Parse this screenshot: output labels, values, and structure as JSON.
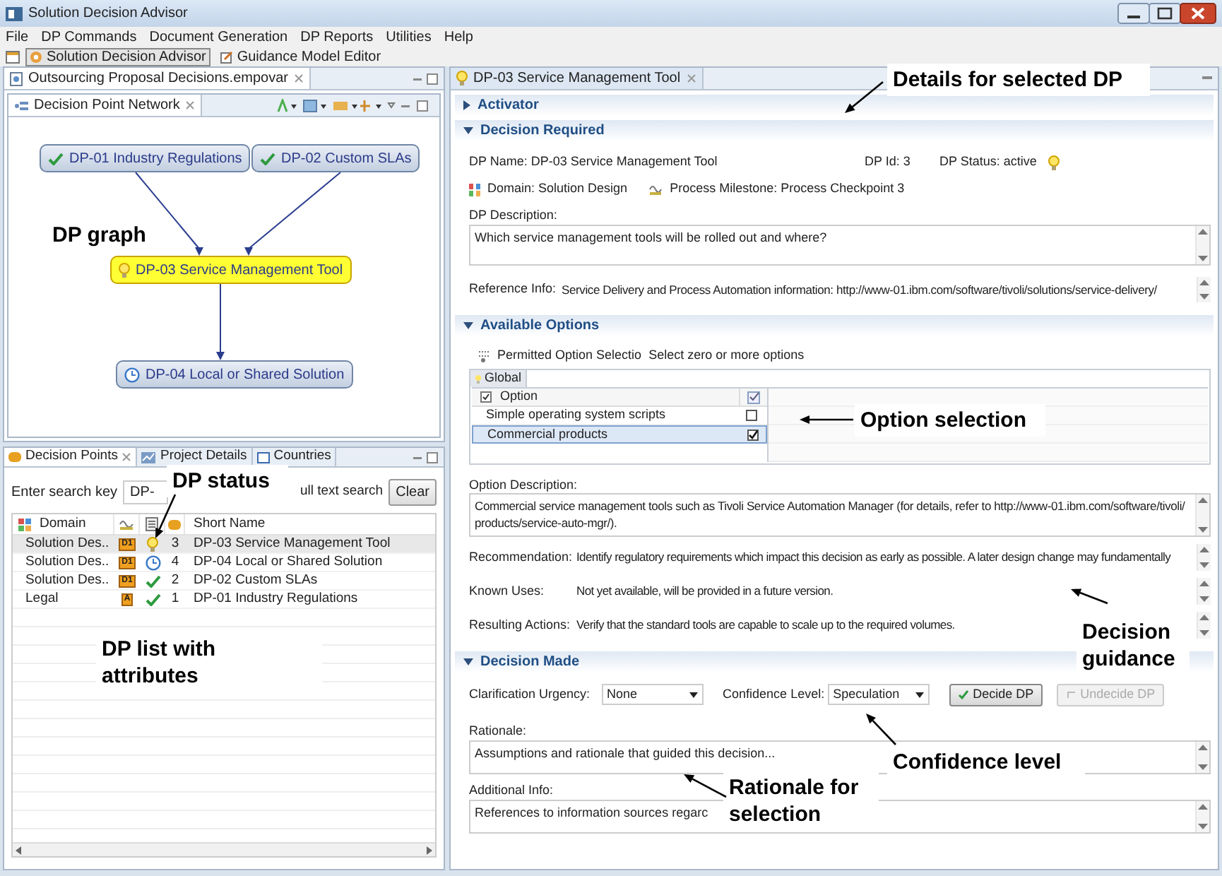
{
  "window": {
    "title": "Solution Decision Advisor"
  },
  "menu": [
    "File",
    "DP Commands",
    "Document Generation",
    "DP Reports",
    "Utilities",
    "Help"
  ],
  "perspectives": [
    {
      "label": "Solution Decision Advisor",
      "selected": true
    },
    {
      "label": "Guidance Model Editor",
      "selected": false
    }
  ],
  "editor_tab": "Outsourcing Proposal Decisions.empovar",
  "network": {
    "tab": "Decision Point Network",
    "nodes": [
      {
        "label": "DP-01 Industry Regulations",
        "kind": "decided",
        "selected": false
      },
      {
        "label": "DP-02 Custom SLAs",
        "kind": "decided",
        "selected": false
      },
      {
        "label": "DP-03 Service Management Tool",
        "kind": "active",
        "selected": true
      },
      {
        "label": "DP-04 Local or Shared Solution",
        "kind": "open",
        "selected": false
      }
    ]
  },
  "points_view": {
    "tabs": [
      {
        "label": "Decision Points",
        "selected": true
      },
      {
        "label": "Project Details",
        "selected": false
      },
      {
        "label": "Countries",
        "selected": false
      }
    ],
    "search_label": "Enter search key",
    "search_value": "DP-",
    "full_text_label": "ull text search",
    "clear_button": "Clear",
    "columns": [
      "Domain",
      "Short Name"
    ],
    "rows": [
      {
        "domain": "Solution Des..",
        "badge": "D1",
        "kind": "active",
        "number": "3",
        "name": "DP-03 Service Management Tool",
        "selected": true
      },
      {
        "domain": "Solution Des..",
        "badge": "D1",
        "kind": "open",
        "number": "4",
        "name": "DP-04 Local or Shared Solution",
        "selected": false
      },
      {
        "domain": "Solution Des..",
        "badge": "D1",
        "kind": "decided",
        "number": "2",
        "name": "DP-02 Custom SLAs",
        "selected": false
      },
      {
        "domain": "Legal",
        "badge": "A",
        "kind": "decided",
        "number": "1",
        "name": "DP-01 Industry Regulations",
        "selected": false
      }
    ]
  },
  "details": {
    "tab": "DP-03 Service Management Tool",
    "activator": {
      "title": "Activator",
      "expanded": false
    },
    "decision_required": {
      "title": "Decision Required",
      "expanded": true,
      "dp_name": "DP Name: DP-03 Service Management Tool",
      "dp_id": "DP Id: 3",
      "dp_status": "DP Status: active",
      "domain": "Domain: Solution Design",
      "milestone": "Process Milestone: Process Checkpoint 3",
      "description_label": "DP Description:",
      "description": "Which service management tools will be rolled out and where?",
      "reference_label": "Reference Info:",
      "reference": "Service Delivery and Process Automation information: http://www-01.ibm.com/software/tivoli/solutions/service-delivery/"
    },
    "available_options": {
      "title": "Available Options",
      "expanded": true,
      "permitted_label": "Permitted Option Selectio",
      "permitted_value": "Select zero or more options",
      "tab": "Global",
      "option_column": "Option",
      "options": [
        {
          "label": "Simple operating system scripts",
          "checked": false,
          "selected": false
        },
        {
          "label": "Commercial products",
          "checked": true,
          "selected": true
        }
      ],
      "description_label": "Option Description:",
      "description": "Commercial service management tools such as Tivoli Service Automation Manager (for details, refer to http://www-01.ibm.com/software/tivoli/products/service-auto-mgr/).",
      "guidance": [
        {
          "label": "Recommendation:",
          "text": "Identify regulatory requirements which impact this decision as early as possible. A later design change may fundamentally"
        },
        {
          "label": "Known Uses:",
          "text": "Not yet available, will be provided in a future version."
        },
        {
          "label": "Resulting Actions:",
          "text": "Verify that the standard tools are capable to scale up to the required volumes."
        }
      ]
    },
    "decision_made": {
      "title": "Decision Made",
      "expanded": true,
      "urgency_label": "Clarification Urgency:",
      "urgency": "None",
      "confidence_label": "Confidence Level:",
      "confidence": "Speculation",
      "buttons": [
        {
          "label": "Decide DP",
          "disabled": false
        },
        {
          "label": "Undecide DP",
          "disabled": true
        }
      ],
      "rationale_label": "Rationale:",
      "rationale": "Assumptions and rationale that guided this decision...",
      "additional_label": "Additional Info:",
      "additional": "References to information sources regarc"
    }
  },
  "annotations": [
    "Details for selected DP",
    "DP graph",
    "DP status",
    "DP list with attributes",
    "Option selection",
    "Decision guidance",
    "Confidence level",
    "Rationale for selection"
  ]
}
